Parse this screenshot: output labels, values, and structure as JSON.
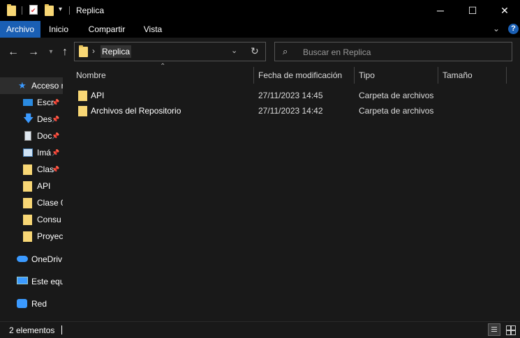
{
  "window": {
    "title": "Replica"
  },
  "ribbon": {
    "tabs": [
      "Archivo",
      "Inicio",
      "Compartir",
      "Vista"
    ]
  },
  "address": {
    "path_item": "Replica"
  },
  "search": {
    "placeholder": "Buscar en Replica"
  },
  "nav_pane": {
    "items": [
      {
        "label": "Acceso r",
        "icon": "star-icon",
        "selected": true
      },
      {
        "label": "Escr",
        "icon": "desktop-icon",
        "pinned": true
      },
      {
        "label": "Des",
        "icon": "download-icon",
        "pinned": true
      },
      {
        "label": "Doc",
        "icon": "document-icon",
        "pinned": true
      },
      {
        "label": "Imá",
        "icon": "image-icon",
        "pinned": true
      },
      {
        "label": "Clas",
        "icon": "folder-icon",
        "pinned": true
      },
      {
        "label": "API",
        "icon": "folder-icon"
      },
      {
        "label": "Clase 0",
        "icon": "folder-icon"
      },
      {
        "label": "Consu",
        "icon": "folder-icon"
      },
      {
        "label": "Proyec",
        "icon": "folder-icon"
      },
      {
        "label": "OneDriv",
        "icon": "cloud-icon"
      },
      {
        "label": "Este equ",
        "icon": "computer-icon"
      },
      {
        "label": "Red",
        "icon": "network-icon"
      }
    ]
  },
  "columns": {
    "name": "Nombre",
    "date": "Fecha de modificación",
    "type": "Tipo",
    "size": "Tamaño"
  },
  "files": [
    {
      "name": "API",
      "date": "27/11/2023 14:45",
      "type": "Carpeta de archivos"
    },
    {
      "name": "Archivos del Repositorio",
      "date": "27/11/2023 14:42",
      "type": "Carpeta de archivos"
    }
  ],
  "status": {
    "count": "2 elementos"
  },
  "colors": {
    "accent": "#1a5fb4",
    "folder": "#f8d775",
    "background": "#191919"
  }
}
